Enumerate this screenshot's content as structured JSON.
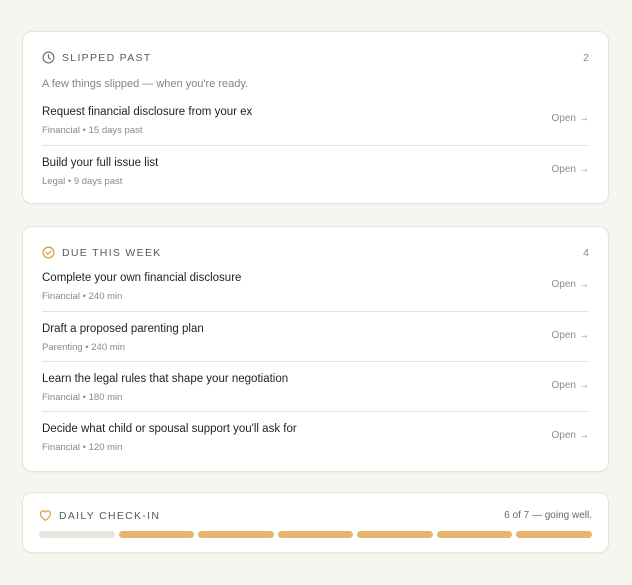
{
  "slipped": {
    "title": "Slipped past",
    "count": "2",
    "intro": "A few things slipped — when you're ready.",
    "items": [
      {
        "title": "Request financial disclosure from your ex",
        "meta": "Financial • 15 days past",
        "action": "Open"
      },
      {
        "title": "Build your full issue list",
        "meta": "Legal • 9 days past",
        "action": "Open"
      }
    ]
  },
  "due": {
    "title": "Due this week",
    "count": "4",
    "items": [
      {
        "title": "Complete your own financial disclosure",
        "meta": "Financial • 240 min",
        "action": "Open"
      },
      {
        "title": "Draft a proposed parenting plan",
        "meta": "Parenting • 240 min",
        "action": "Open"
      },
      {
        "title": "Learn the legal rules that shape your negotiation",
        "meta": "Financial • 180 min",
        "action": "Open"
      },
      {
        "title": "Decide what child or spousal support you'll ask for",
        "meta": "Financial • 120 min",
        "action": "Open"
      }
    ]
  },
  "checkin": {
    "title": "Daily check-in",
    "status": "6 of 7 — going well.",
    "completed": 6,
    "total": 7
  },
  "colors": {
    "accent": "#e5b56e",
    "icon_accent": "#d9983a"
  }
}
